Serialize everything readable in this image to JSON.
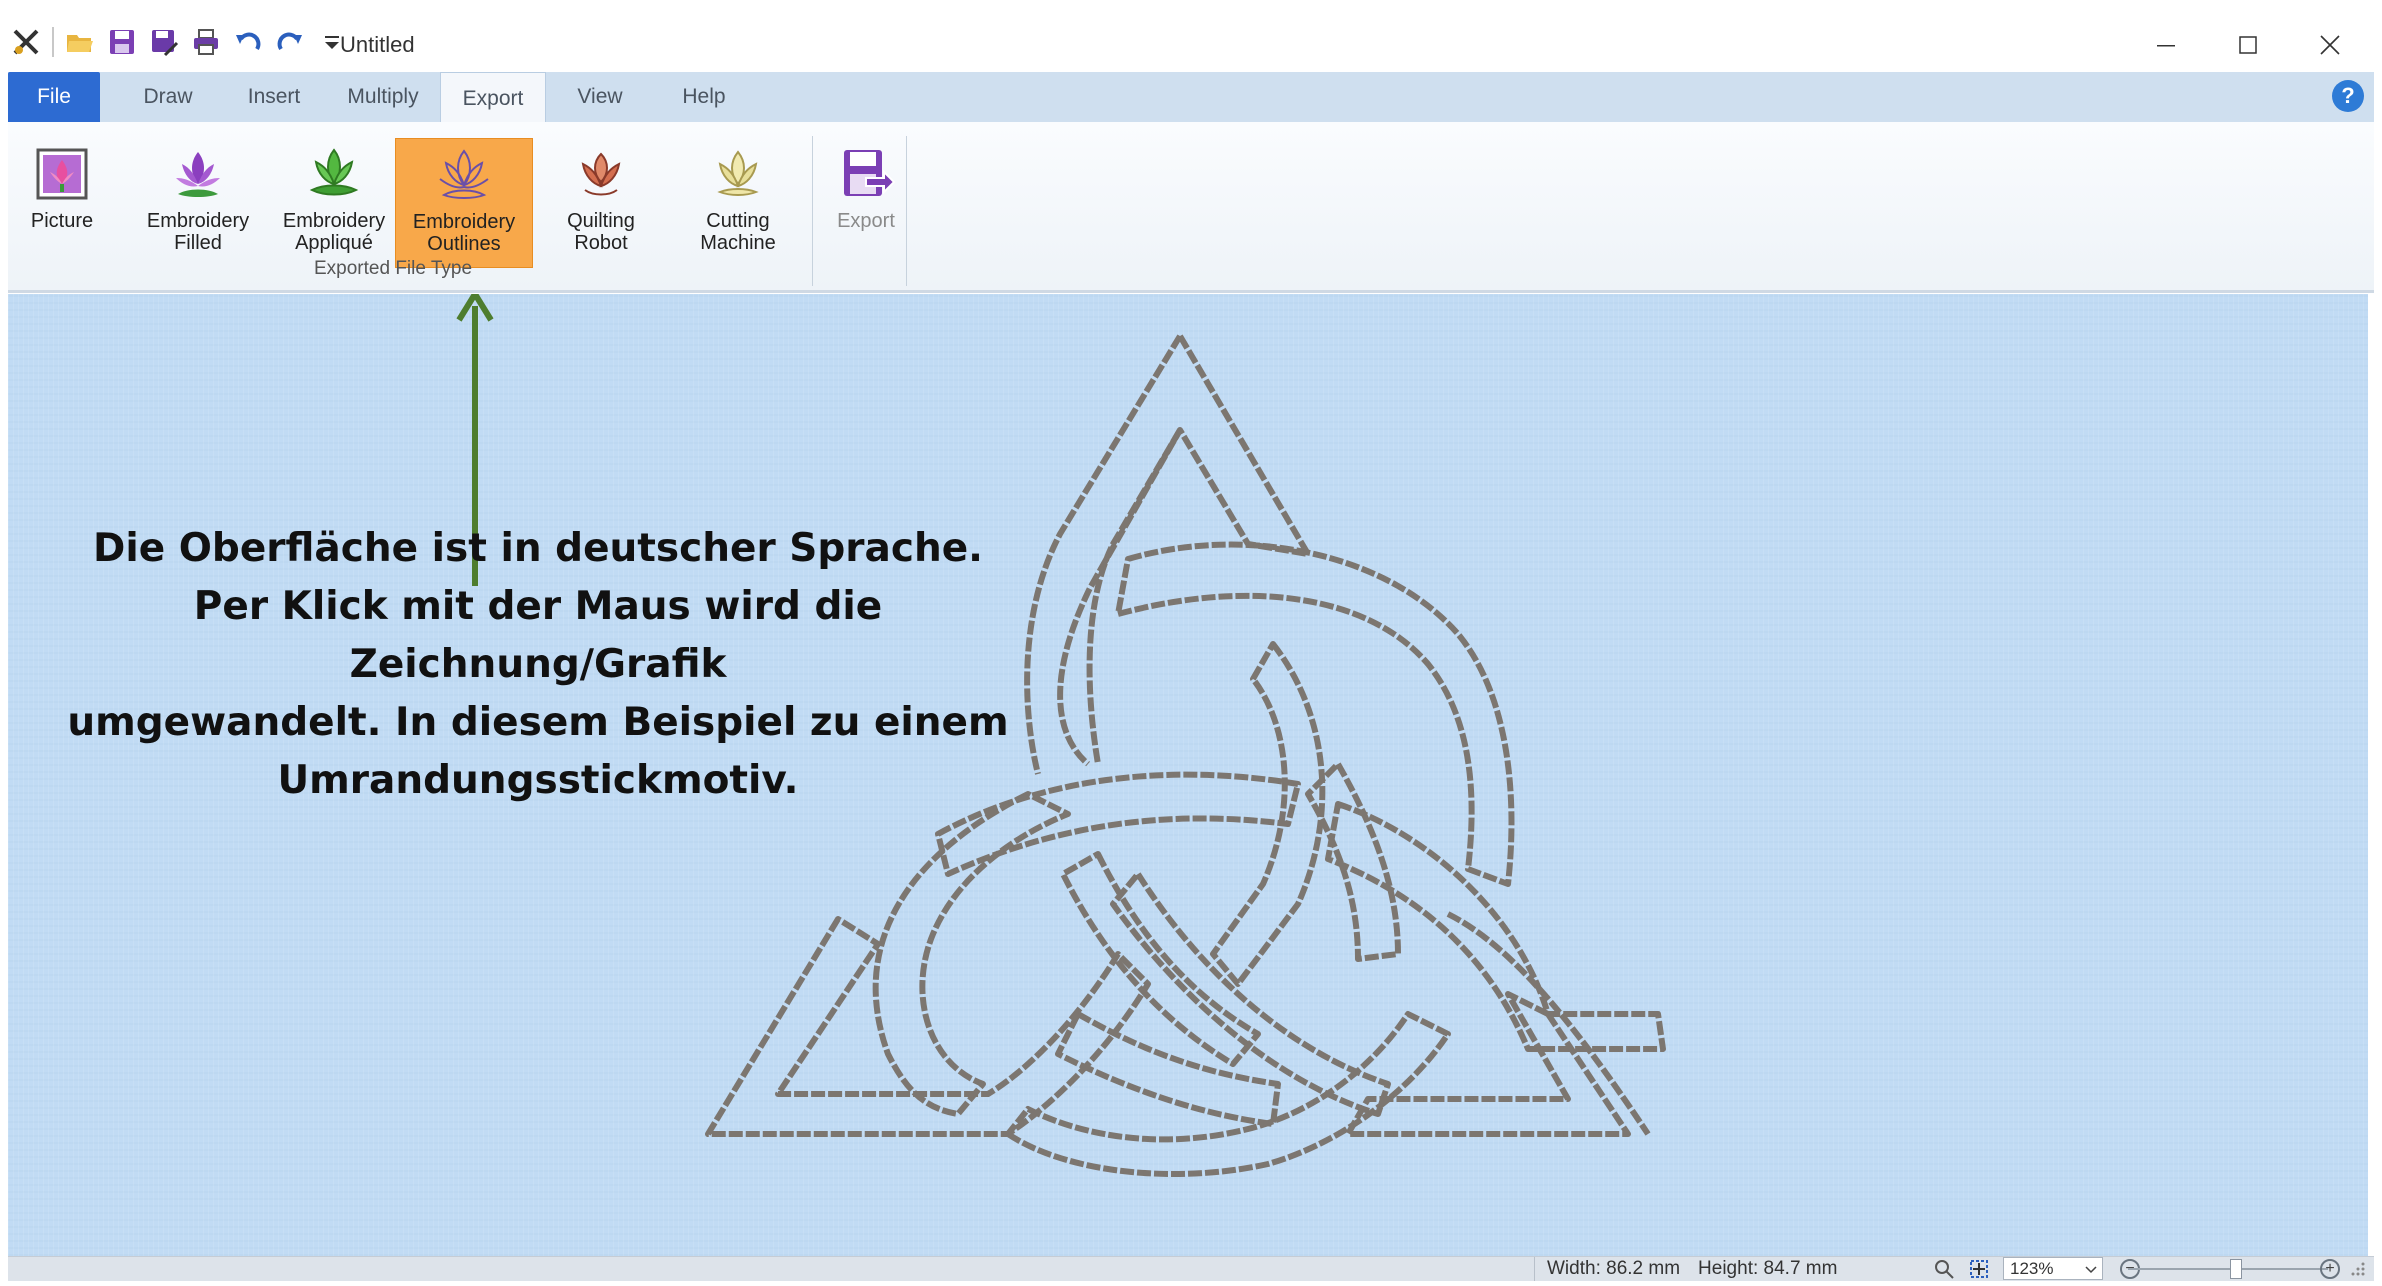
{
  "window": {
    "title": "Untitled"
  },
  "tabs": {
    "file": "File",
    "draw": "Draw",
    "insert": "Insert",
    "multiply": "Multiply",
    "export": "Export",
    "view": "View",
    "help": "Help",
    "active": "Export"
  },
  "ribbon": {
    "buttons": [
      {
        "label": "Picture",
        "icon": "picture-icon"
      },
      {
        "label": "Embroidery\nFilled",
        "icon": "embroidery-filled-icon"
      },
      {
        "label": "Embroidery\nAppliqué",
        "icon": "embroidery-applique-icon"
      },
      {
        "label": "Embroidery\nOutlines",
        "icon": "embroidery-outlines-icon",
        "selected": true
      },
      {
        "label": "Quilting\nRobot",
        "icon": "quilting-robot-icon"
      },
      {
        "label": "Cutting\nMachine",
        "icon": "cutting-machine-icon"
      }
    ],
    "group_label": "Exported File Type",
    "export_button": {
      "label": "Export",
      "icon": "export-icon",
      "disabled": true
    }
  },
  "annotation": {
    "line1": "Die Oberfläche ist in deutscher Sprache.",
    "line2": "Per Klick mit der Maus wird die Zeichnung/Grafik",
    "line3": "umgewandelt. In diesem Beispiel zu einem",
    "line4": "Umrandungsstickmotiv."
  },
  "status": {
    "width": "Width: 86.2 mm",
    "height": "Height: 84.7 mm",
    "zoom": "123%"
  },
  "colors": {
    "canvas_bg": "#c1dbf4",
    "active_button": "#f8a84a",
    "file_tab": "#2d6bd2",
    "arrow": "#4e7d2e",
    "stitch": "#7c7670"
  }
}
